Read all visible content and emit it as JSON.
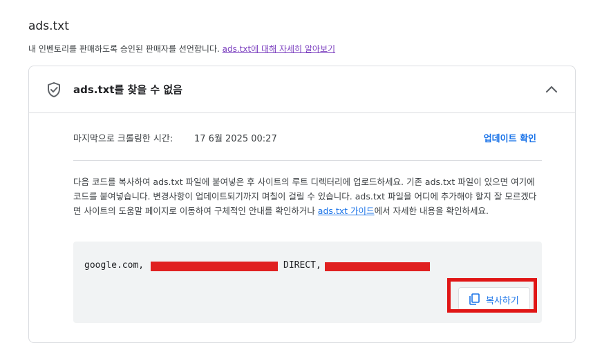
{
  "header": {
    "title": "ads.txt",
    "subtitle": "내 인벤토리를 판매하도록 승인된 판매자를 선언합니다.",
    "learn_more_link": "ads.txt에 대해 자세히 알아보기"
  },
  "status_card": {
    "status_label": "ads.txt를 찾을 수 없음",
    "crawl_label": "마지막으로 크롤링한 시간:",
    "crawl_value": "17 6월 2025 00:27",
    "update_check_label": "업데이트 확인",
    "instructions_part1": "다음 코드를 복사하여 ads.txt 파일에 붙여넣은 후 사이트의 루트 디렉터리에 업로드하세요. 기존 ads.txt 파일이 있으면 여기에 코드를 붙여넣습니다. 변경사항이 업데이트되기까지 며칠이 걸릴 수 있습니다. ads.txt 파일을 어디에 추가해야 할지 잘 모르겠다면 사이트의 도움말 페이지로 이동하여 구체적인 안내를 확인하거나 ",
    "instructions_link": "ads.txt 가이드",
    "instructions_part2": "에서 자세한 내용을 확인하세요.",
    "code_prefix": "google.com,",
    "code_middle": "DIRECT,",
    "copy_button_label": "복사하기"
  },
  "icons": [
    "shield-check-icon",
    "chevron-up-icon",
    "copy-icon"
  ],
  "colors": {
    "link_blue": "#1a73e8",
    "visited_link": "#7b3fbf",
    "redaction_red": "#e02020",
    "highlight_red": "#e01515"
  }
}
